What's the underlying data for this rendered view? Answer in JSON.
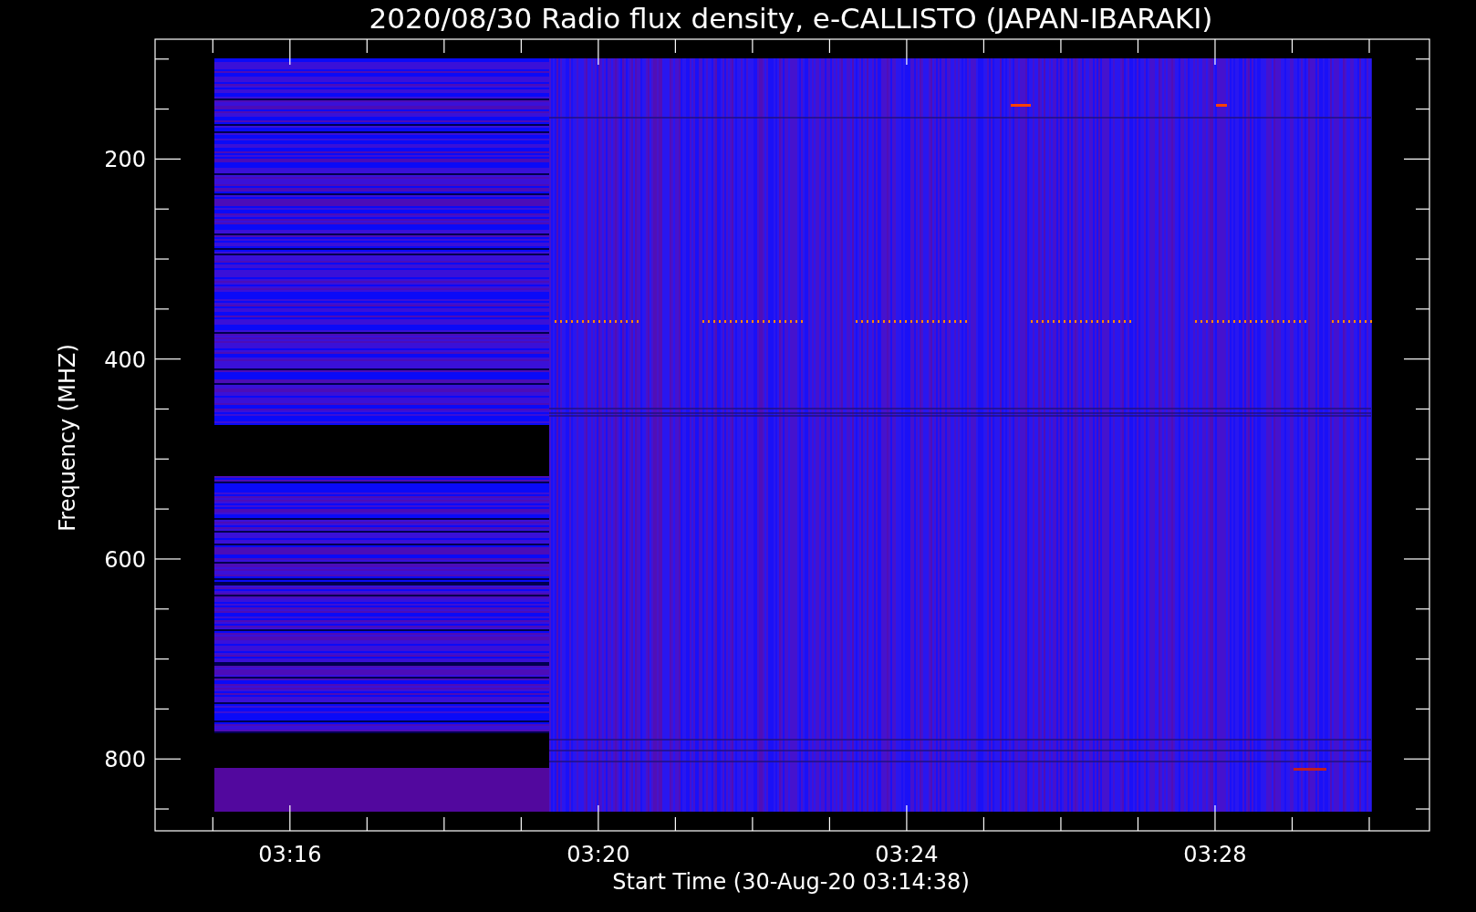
{
  "title": "2020/08/30  Radio flux density, e-CALLISTO (JAPAN-IBARAKI)",
  "y_axis": {
    "label": "Frequency (MHZ)",
    "ticks": [
      "200",
      "400",
      "600",
      "800"
    ]
  },
  "x_axis": {
    "label": "Start Time (30-Aug-20 03:14:38)",
    "ticks": [
      "03:16",
      "03:20",
      "03:24",
      "03:28"
    ]
  }
}
